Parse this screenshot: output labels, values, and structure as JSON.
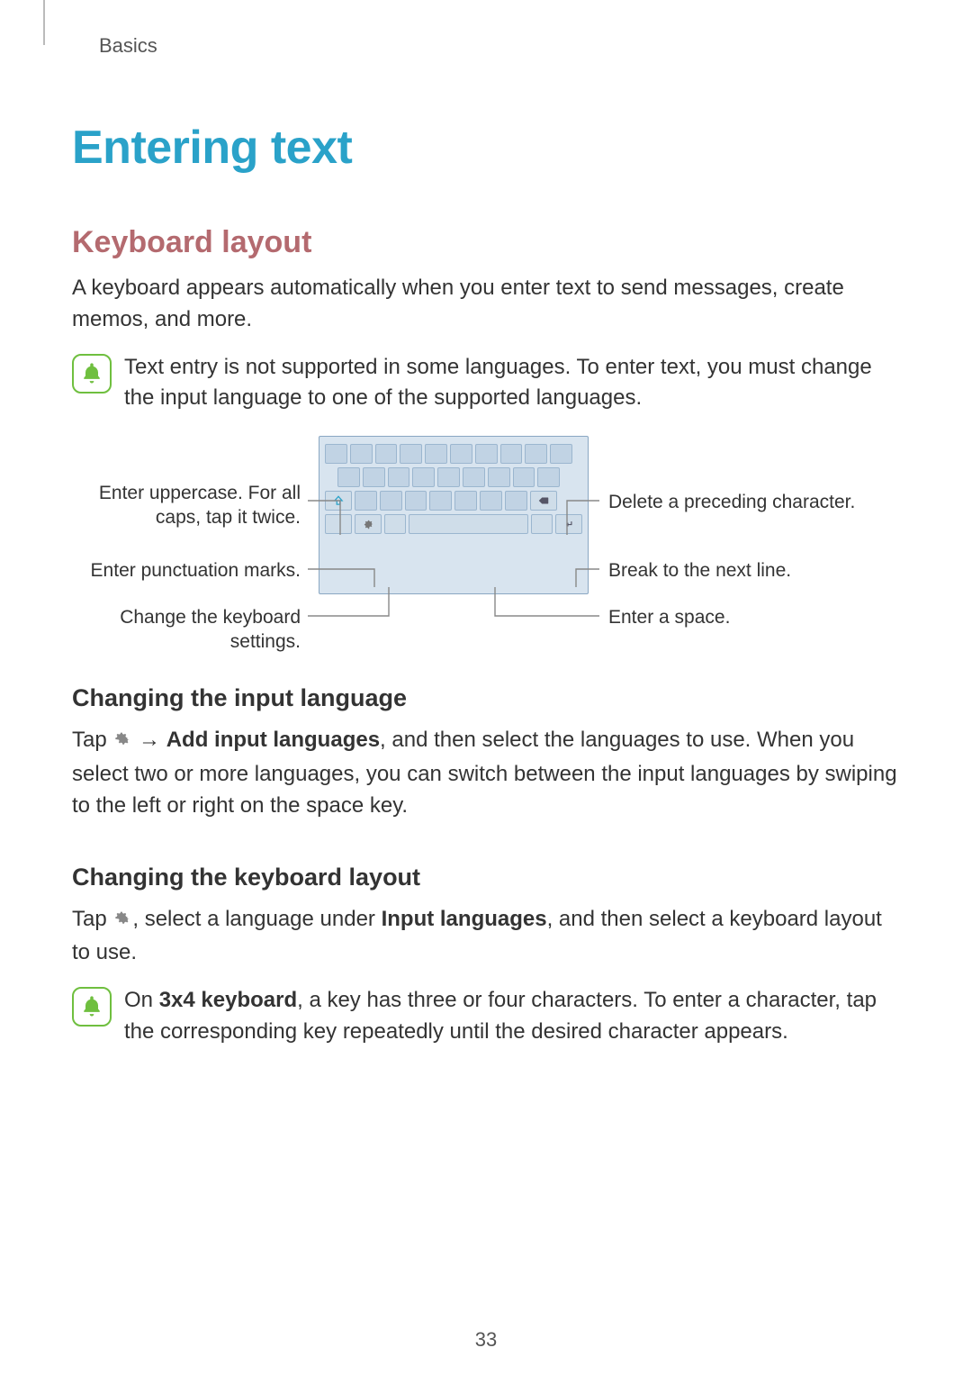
{
  "breadcrumb": "Basics",
  "h1": "Entering text",
  "h2": "Keyboard layout",
  "intro": "A keyboard appears automatically when you enter text to send messages, create memos, and more.",
  "note1": "Text entry is not supported in some languages. To enter text, you must change the input language to one of the supported languages.",
  "callouts": {
    "uppercase": "Enter uppercase. For all caps, tap it twice.",
    "punct": "Enter punctuation marks.",
    "settings": "Change the keyboard settings.",
    "delete": "Delete a preceding character.",
    "nextline": "Break to the next line.",
    "space": "Enter a space."
  },
  "h3a": "Changing the input language",
  "p_lang_pre": "Tap ",
  "p_lang_arrow": " → ",
  "p_lang_bold": "Add input languages",
  "p_lang_post": ", and then select the languages to use. When you select two or more languages, you can switch between the input languages by swiping to the left or right on the space key.",
  "h3b": "Changing the keyboard layout",
  "p_layout_pre": "Tap ",
  "p_layout_mid": ", select a language under ",
  "p_layout_bold": "Input languages",
  "p_layout_post": ", and then select a keyboard layout to use.",
  "note2_pre": "On ",
  "note2_bold": "3x4 keyboard",
  "note2_post": ", a key has three or four characters. To enter a character, tap the corresponding key repeatedly until the desired character appears.",
  "page_number": "33"
}
